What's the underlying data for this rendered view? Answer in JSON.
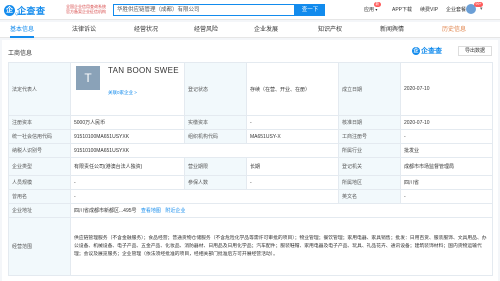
{
  "header": {
    "logo_char": "企",
    "logo_text": "企查查",
    "logo_sub": "Qcc.com",
    "official": "全国企业信用查询系统 官方备案企业征信机构",
    "search_value": "华胜供应链管理（成都）有限公司",
    "search_button": "查一下",
    "nav": {
      "app": "应用",
      "app_badge": "新",
      "download": "APP下载",
      "vip": "续费VIP",
      "enterprise": "企业套餐"
    },
    "avatar_badge": "99+"
  },
  "tabs": [
    {
      "label": "基本信息",
      "count": ""
    },
    {
      "label": "法律诉讼",
      "count": ""
    },
    {
      "label": "经营状况",
      "count": ""
    },
    {
      "label": "经营风险",
      "count": ""
    },
    {
      "label": "企业发展",
      "count": ""
    },
    {
      "label": "知识产权",
      "count": ""
    },
    {
      "label": "新闻舆情",
      "count": ""
    },
    {
      "label": "历史信息",
      "count": ""
    }
  ],
  "panel": {
    "title": "工商信息",
    "logo_char": "企",
    "logo_text": "企查查",
    "export_label": "导出数据"
  },
  "info": {
    "legal_label": "法定代表人",
    "legal_avatar": "T",
    "legal_name": "TAN BOON SWEE",
    "legal_link": "关联0家企业 >",
    "status_label": "登记状态",
    "status_value": "存续（在营、开业、在册）",
    "found_label": "成立日期",
    "found_value": "2020-07-10",
    "capital_label": "注册资本",
    "capital_value": "5000万人民币",
    "paid_label": "实缴资本",
    "paid_value": "-",
    "approve_label": "核准日期",
    "approve_value": "2020-07-10",
    "credit_label": "统一社会信用代码",
    "credit_value": "91510100MA651USYXK",
    "org_label": "组织机构代码",
    "org_value": "MA651USY-X",
    "reg_no_label": "工商注册号",
    "reg_no_value": "-",
    "tax_label": "纳税人识别号",
    "tax_value": "91510100MA651USYXK",
    "industry_label": "所属行业",
    "industry_value": "批发业",
    "type_label": "企业类型",
    "type_value": "有限责任公司(港澳台法人独资)",
    "term_label": "营业期限",
    "term_value": "长期",
    "authority_label": "登记机关",
    "authority_value": "成都市市场监督管理局",
    "staff_label": "人员规模",
    "staff_value": "-",
    "insured_label": "参保人数",
    "insured_value": "-",
    "region_label": "所属地区",
    "region_value": "四川省",
    "former_label": "曾用名",
    "former_value": "-",
    "en_label": "英文名",
    "en_value": "-",
    "address_label": "企业地址",
    "address_value": "四川省成都市新都区...495号",
    "address_map": "查看地图",
    "address_nearby": "附近企业",
    "scope_label": "经营范围",
    "scope_value": "供应链管理服务（不含金融服务）；食品经营；普通货物仓储服务（不含危险化学品等需许可审批的项目）；物业管理；餐饮管理；家用电器、家具销售；批发：日用百货、服装服饰、文具用品、办公设备、机械设备、电子产品、五金产品、化妆品、消防器材、日用品及日用化学品；汽车配件；服装鞋帽、家用电器及电子产品、玩具、礼品花卉、通讯设备；建筑装饰材料；国内货物运输代理；会议及展览服务；企业管理（依法须经批准的项目，经相关部门批准后方可开展经营活动）。"
  }
}
